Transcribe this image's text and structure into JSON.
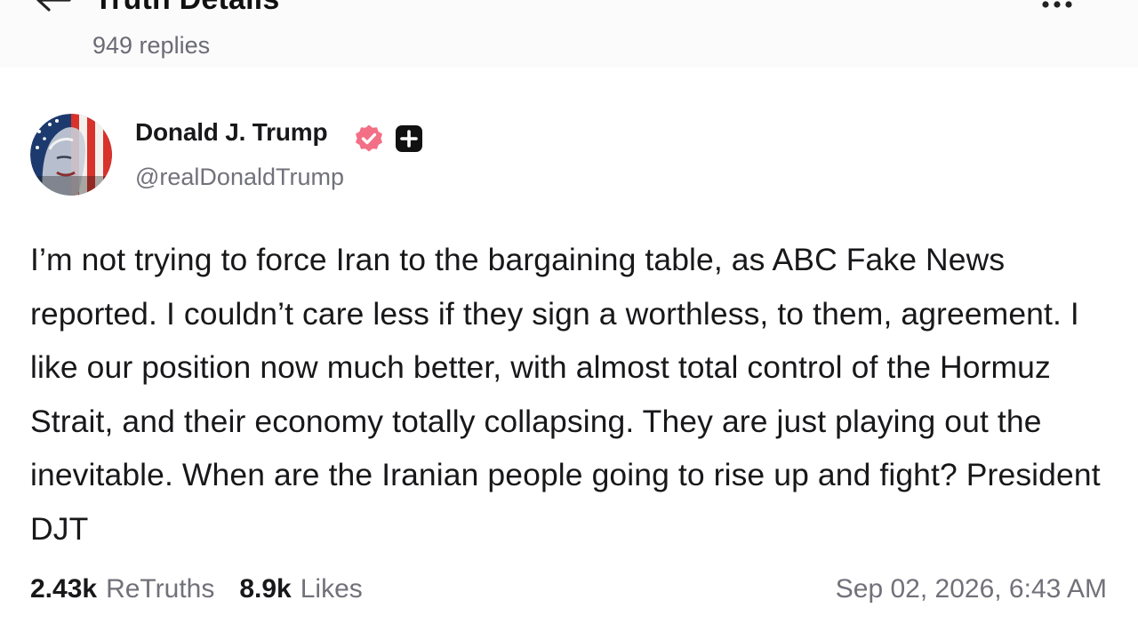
{
  "header": {
    "title": "Truth Details",
    "replies": "949 replies",
    "back_icon": "arrow-left-icon",
    "more_icon": "more-horizontal-icon"
  },
  "post": {
    "author": {
      "name": "Donald J. Trump",
      "handle": "@realDonaldTrump",
      "verified_icon": "verified-badge-icon",
      "verified_color": "#f36f86",
      "plus_icon": "plus-badge-icon"
    },
    "text": "I’m not trying to force Iran to the bargaining table, as ABC Fake News reported. I couldn’t care less if they sign a worthless, to them, agreement. I like our position now much better, with almost total control of the Hormuz Strait, and their economy totally collapsing. They are just playing out the inevitable. When are the Iranian people going to rise up and fight? President DJT",
    "stats": {
      "retruths_count": "2.43k",
      "retruths_label": "ReTruths",
      "likes_count": "8.9k",
      "likes_label": "Likes"
    },
    "timestamp": "Sep 02, 2026, 6:43 AM"
  },
  "colors": {
    "text": "#18181b",
    "muted": "#71717a",
    "header_bg": "#fbfbfb"
  }
}
